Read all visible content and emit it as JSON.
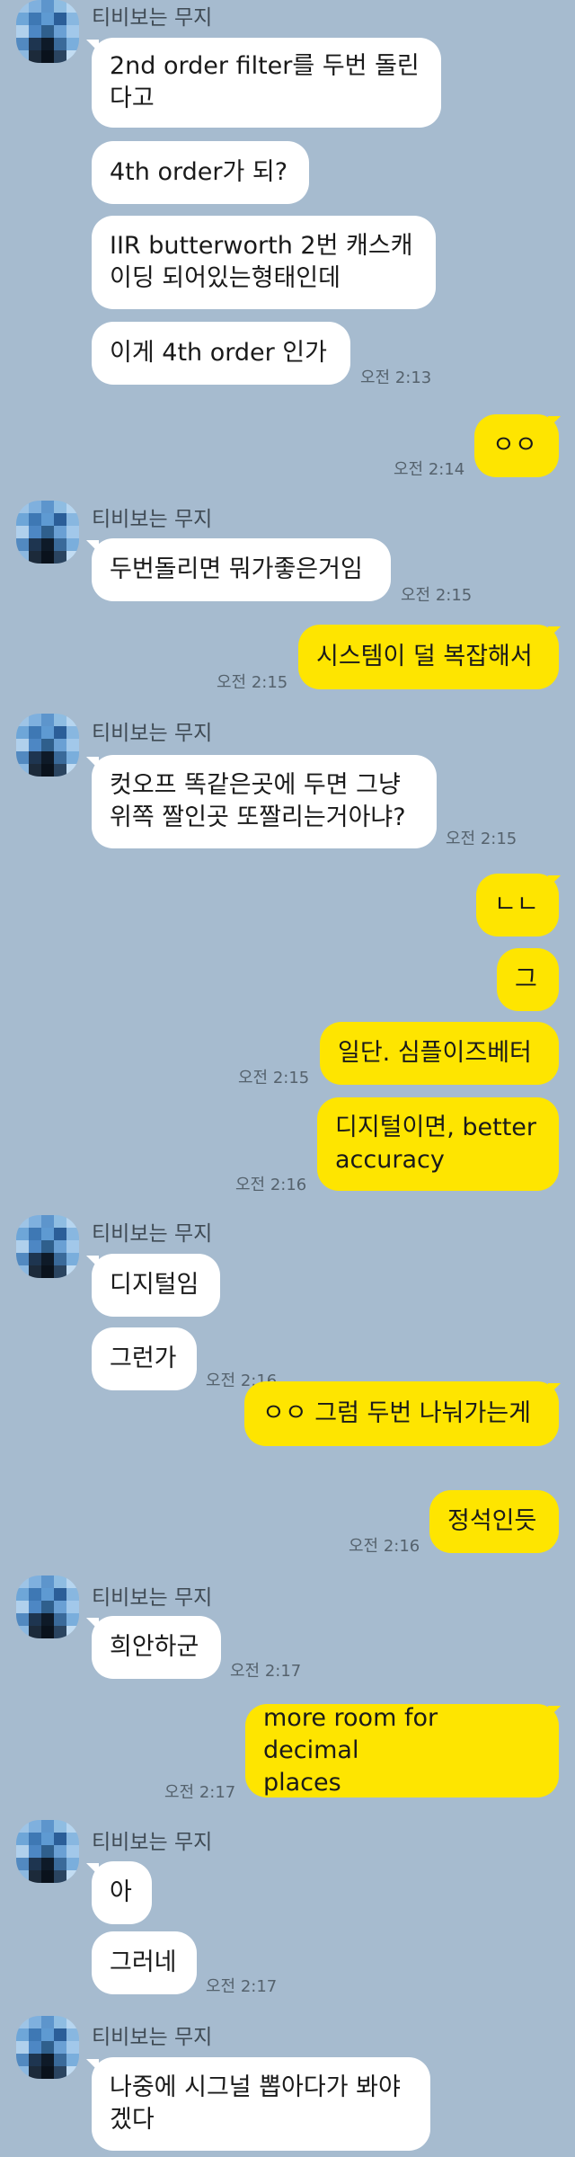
{
  "sender": "티비보는 무지",
  "messages": [
    {
      "text": "2nd order filter를 두번 돌린\n다고"
    },
    {
      "text": "4th order가 되?"
    },
    {
      "text": "IIR butterworth 2번 캐스캐\n이딩 되어있는형태인데"
    },
    {
      "text": "이게 4th order 인가",
      "time": "오전 2:13"
    },
    {
      "text": "ㅇㅇ",
      "time": "오전 2:14"
    },
    {
      "text": "두번돌리면 뭐가좋은거임",
      "time": "오전 2:15"
    },
    {
      "text": "시스템이 덜 복잡해서",
      "time": "오전 2:15"
    },
    {
      "text": "컷오프 똑같은곳에 두면 그냥\n위쪽 짤인곳 또짤리는거아냐?",
      "time": "오전 2:15"
    },
    {
      "text": "ㄴㄴ"
    },
    {
      "text": "그"
    },
    {
      "text": "일단. 심플이즈베터",
      "time": "오전 2:15"
    },
    {
      "text": "디지털이면, better\naccuracy",
      "time": "오전 2:16"
    },
    {
      "text": "디지털임"
    },
    {
      "text": "그런가",
      "time": "오전 2:16"
    },
    {
      "text": "ㅇㅇ 그럼 두번 나눠가는게"
    },
    {
      "text": "정석인듯",
      "time": "오전 2:16"
    },
    {
      "text": "희안하군",
      "time": "오전 2:17"
    },
    {
      "text": "more room for decimal\nplaces",
      "time": "오전 2:17"
    },
    {
      "text": "아"
    },
    {
      "text": "그러네",
      "time": "오전 2:17"
    },
    {
      "text": "나중에 시그널 뽑아다가 봐야\n겠다"
    }
  ],
  "colors": {
    "background": "#a6bbcf",
    "incoming_bubble": "#ffffff",
    "outgoing_bubble": "#fee500",
    "timestamp": "#55626d"
  },
  "icons": {
    "avatar": "pixelated-avatar-icon"
  }
}
